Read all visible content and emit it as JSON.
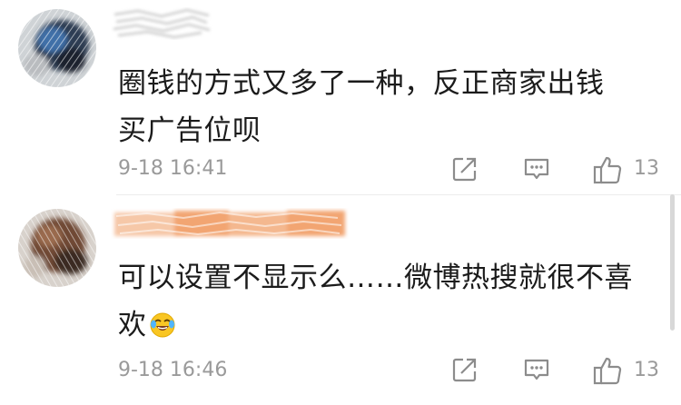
{
  "comments": [
    {
      "text_line1": "圈钱的方式又多了一种，反正商家出钱",
      "text_line2": "买广告位呗",
      "timestamp": "9-18 16:41",
      "like_count": "13"
    },
    {
      "text_line1": "可以设置不显示么……微博热搜就很不喜",
      "text_line2": "欢",
      "emoji_icon": "laughing-tears-emoji",
      "timestamp": "9-18 16:46",
      "like_count": "13"
    }
  ],
  "icons": {
    "share": "share-icon",
    "comment": "comment-icon",
    "like": "thumbs-up-icon"
  },
  "colors": {
    "text": "#1b1b1b",
    "meta": "#9a9a9a",
    "redaction_orange": "#f2a572"
  }
}
